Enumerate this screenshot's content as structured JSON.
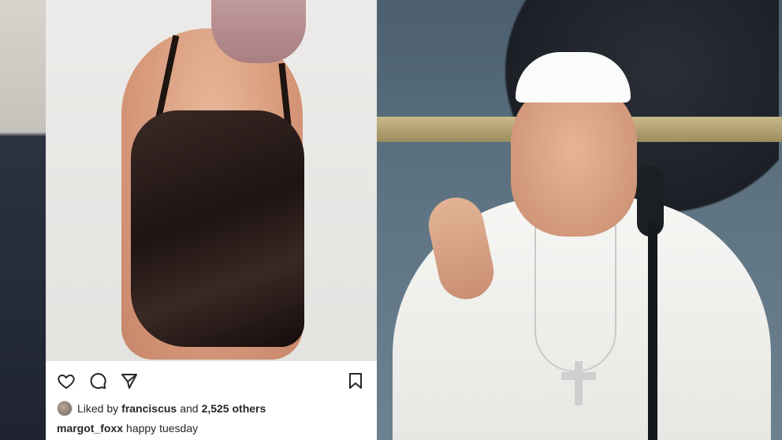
{
  "left_panel": {
    "post": {
      "actions": {
        "like_icon": "heart-icon",
        "comment_icon": "comment-icon",
        "share_icon": "send-icon",
        "save_icon": "bookmark-icon"
      },
      "likes": {
        "prefix": "Liked by",
        "user": "franciscus",
        "joiner": "and",
        "others": "2,525 others"
      },
      "caption": {
        "username": "margot_foxx",
        "text": "happy tuesday"
      }
    }
  },
  "colors": {
    "text": "#262626",
    "post_bar_bg": "#ffffff"
  }
}
